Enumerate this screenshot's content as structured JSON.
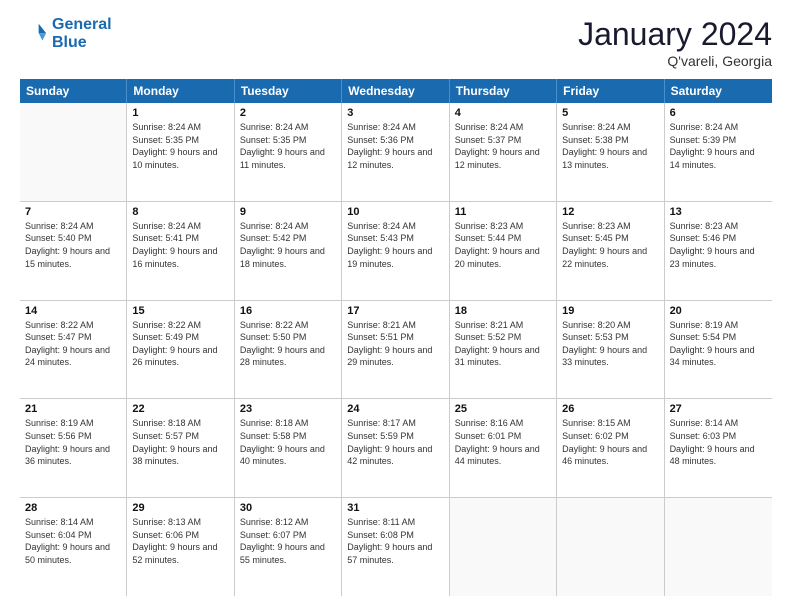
{
  "logo": {
    "line1": "General",
    "line2": "Blue"
  },
  "title": "January 2024",
  "location": "Q'vareli, Georgia",
  "days_of_week": [
    "Sunday",
    "Monday",
    "Tuesday",
    "Wednesday",
    "Thursday",
    "Friday",
    "Saturday"
  ],
  "weeks": [
    [
      {
        "day": "",
        "empty": true
      },
      {
        "day": "1",
        "sunrise": "8:24 AM",
        "sunset": "5:35 PM",
        "daylight": "9 hours and 10 minutes."
      },
      {
        "day": "2",
        "sunrise": "8:24 AM",
        "sunset": "5:35 PM",
        "daylight": "9 hours and 11 minutes."
      },
      {
        "day": "3",
        "sunrise": "8:24 AM",
        "sunset": "5:36 PM",
        "daylight": "9 hours and 12 minutes."
      },
      {
        "day": "4",
        "sunrise": "8:24 AM",
        "sunset": "5:37 PM",
        "daylight": "9 hours and 12 minutes."
      },
      {
        "day": "5",
        "sunrise": "8:24 AM",
        "sunset": "5:38 PM",
        "daylight": "9 hours and 13 minutes."
      },
      {
        "day": "6",
        "sunrise": "8:24 AM",
        "sunset": "5:39 PM",
        "daylight": "9 hours and 14 minutes."
      }
    ],
    [
      {
        "day": "7",
        "sunrise": "8:24 AM",
        "sunset": "5:40 PM",
        "daylight": "9 hours and 15 minutes."
      },
      {
        "day": "8",
        "sunrise": "8:24 AM",
        "sunset": "5:41 PM",
        "daylight": "9 hours and 16 minutes."
      },
      {
        "day": "9",
        "sunrise": "8:24 AM",
        "sunset": "5:42 PM",
        "daylight": "9 hours and 18 minutes."
      },
      {
        "day": "10",
        "sunrise": "8:24 AM",
        "sunset": "5:43 PM",
        "daylight": "9 hours and 19 minutes."
      },
      {
        "day": "11",
        "sunrise": "8:23 AM",
        "sunset": "5:44 PM",
        "daylight": "9 hours and 20 minutes."
      },
      {
        "day": "12",
        "sunrise": "8:23 AM",
        "sunset": "5:45 PM",
        "daylight": "9 hours and 22 minutes."
      },
      {
        "day": "13",
        "sunrise": "8:23 AM",
        "sunset": "5:46 PM",
        "daylight": "9 hours and 23 minutes."
      }
    ],
    [
      {
        "day": "14",
        "sunrise": "8:22 AM",
        "sunset": "5:47 PM",
        "daylight": "9 hours and 24 minutes."
      },
      {
        "day": "15",
        "sunrise": "8:22 AM",
        "sunset": "5:49 PM",
        "daylight": "9 hours and 26 minutes."
      },
      {
        "day": "16",
        "sunrise": "8:22 AM",
        "sunset": "5:50 PM",
        "daylight": "9 hours and 28 minutes."
      },
      {
        "day": "17",
        "sunrise": "8:21 AM",
        "sunset": "5:51 PM",
        "daylight": "9 hours and 29 minutes."
      },
      {
        "day": "18",
        "sunrise": "8:21 AM",
        "sunset": "5:52 PM",
        "daylight": "9 hours and 31 minutes."
      },
      {
        "day": "19",
        "sunrise": "8:20 AM",
        "sunset": "5:53 PM",
        "daylight": "9 hours and 33 minutes."
      },
      {
        "day": "20",
        "sunrise": "8:19 AM",
        "sunset": "5:54 PM",
        "daylight": "9 hours and 34 minutes."
      }
    ],
    [
      {
        "day": "21",
        "sunrise": "8:19 AM",
        "sunset": "5:56 PM",
        "daylight": "9 hours and 36 minutes."
      },
      {
        "day": "22",
        "sunrise": "8:18 AM",
        "sunset": "5:57 PM",
        "daylight": "9 hours and 38 minutes."
      },
      {
        "day": "23",
        "sunrise": "8:18 AM",
        "sunset": "5:58 PM",
        "daylight": "9 hours and 40 minutes."
      },
      {
        "day": "24",
        "sunrise": "8:17 AM",
        "sunset": "5:59 PM",
        "daylight": "9 hours and 42 minutes."
      },
      {
        "day": "25",
        "sunrise": "8:16 AM",
        "sunset": "6:01 PM",
        "daylight": "9 hours and 44 minutes."
      },
      {
        "day": "26",
        "sunrise": "8:15 AM",
        "sunset": "6:02 PM",
        "daylight": "9 hours and 46 minutes."
      },
      {
        "day": "27",
        "sunrise": "8:14 AM",
        "sunset": "6:03 PM",
        "daylight": "9 hours and 48 minutes."
      }
    ],
    [
      {
        "day": "28",
        "sunrise": "8:14 AM",
        "sunset": "6:04 PM",
        "daylight": "9 hours and 50 minutes."
      },
      {
        "day": "29",
        "sunrise": "8:13 AM",
        "sunset": "6:06 PM",
        "daylight": "9 hours and 52 minutes."
      },
      {
        "day": "30",
        "sunrise": "8:12 AM",
        "sunset": "6:07 PM",
        "daylight": "9 hours and 55 minutes."
      },
      {
        "day": "31",
        "sunrise": "8:11 AM",
        "sunset": "6:08 PM",
        "daylight": "9 hours and 57 minutes."
      },
      {
        "day": "",
        "empty": true
      },
      {
        "day": "",
        "empty": true
      },
      {
        "day": "",
        "empty": true
      }
    ]
  ],
  "labels": {
    "sunrise": "Sunrise:",
    "sunset": "Sunset:",
    "daylight": "Daylight:"
  }
}
